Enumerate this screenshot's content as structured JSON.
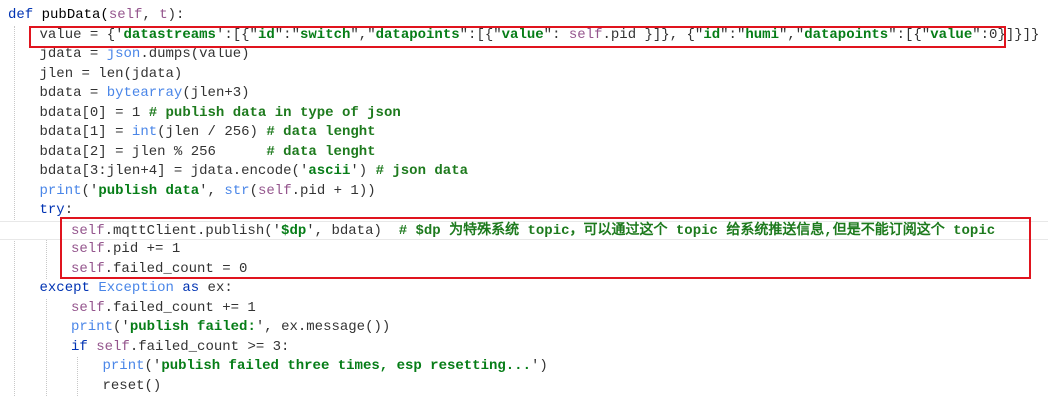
{
  "editor": {
    "lines": [
      {
        "indent": 0,
        "tokens": [
          [
            "kw",
            "def "
          ],
          [
            "def",
            "pubData("
          ],
          [
            "self",
            "self"
          ],
          [
            "plain",
            ", "
          ],
          [
            "self",
            "t"
          ],
          [
            "plain",
            "):"
          ]
        ]
      },
      {
        "indent": 1,
        "tokens": [
          [
            "plain",
            "value = {'"
          ],
          [
            "str",
            "datastreams"
          ],
          [
            "plain",
            "':[{\""
          ],
          [
            "str",
            "id"
          ],
          [
            "plain",
            "\":\""
          ],
          [
            "str",
            "switch"
          ],
          [
            "plain",
            "\",\""
          ],
          [
            "str",
            "datapoints"
          ],
          [
            "plain",
            "\":[{\""
          ],
          [
            "str",
            "value"
          ],
          [
            "plain",
            "\": "
          ],
          [
            "self",
            "self"
          ],
          [
            "plain",
            ".pid }]}, {\""
          ],
          [
            "str",
            "id"
          ],
          [
            "plain",
            "\":\""
          ],
          [
            "str",
            "humi"
          ],
          [
            "plain",
            "\",\""
          ],
          [
            "str",
            "datapoints"
          ],
          [
            "plain",
            "\":[{\""
          ],
          [
            "str",
            "value"
          ],
          [
            "plain",
            "\":0}]}]}"
          ]
        ]
      },
      {
        "indent": 1,
        "tokens": [
          [
            "plain",
            "jdata = "
          ],
          [
            "builtin",
            "json"
          ],
          [
            "plain",
            ".dumps(value)"
          ]
        ]
      },
      {
        "indent": 1,
        "tokens": [
          [
            "plain",
            "jlen = len(jdata)"
          ]
        ]
      },
      {
        "indent": 1,
        "tokens": [
          [
            "plain",
            "bdata = "
          ],
          [
            "builtin",
            "bytearray"
          ],
          [
            "plain",
            "(jlen+3)"
          ]
        ]
      },
      {
        "indent": 1,
        "tokens": [
          [
            "plain",
            "bdata[0] = 1 "
          ],
          [
            "com",
            "# publish data in type of json"
          ]
        ]
      },
      {
        "indent": 1,
        "tokens": [
          [
            "plain",
            "bdata[1] = "
          ],
          [
            "builtin",
            "int"
          ],
          [
            "plain",
            "(jlen / 256) "
          ],
          [
            "com",
            "# data lenght"
          ]
        ]
      },
      {
        "indent": 1,
        "tokens": [
          [
            "plain",
            "bdata[2] = jlen % 256      "
          ],
          [
            "com",
            "# data lenght"
          ]
        ]
      },
      {
        "indent": 1,
        "tokens": [
          [
            "plain",
            "bdata[3:jlen+4] = jdata.encode('"
          ],
          [
            "str",
            "ascii"
          ],
          [
            "plain",
            "') "
          ],
          [
            "com",
            "# json data"
          ]
        ]
      },
      {
        "indent": 1,
        "tokens": [
          [
            "builtin",
            "print"
          ],
          [
            "plain",
            "('"
          ],
          [
            "str",
            "publish data"
          ],
          [
            "plain",
            "', "
          ],
          [
            "builtin",
            "str"
          ],
          [
            "plain",
            "("
          ],
          [
            "self",
            "self"
          ],
          [
            "plain",
            ".pid + 1))"
          ]
        ]
      },
      {
        "indent": 1,
        "tokens": [
          [
            "kw",
            "try"
          ],
          [
            "plain",
            ":"
          ]
        ]
      },
      {
        "indent": 2,
        "current": true,
        "tokens": [
          [
            "self",
            "self"
          ],
          [
            "plain",
            ".mqttClient.publish('"
          ],
          [
            "str",
            "$dp"
          ],
          [
            "plain",
            "', bdata)  "
          ],
          [
            "com",
            "# $dp 为特殊系统 topic，可以通过这个 topic 给系统推送信息,但是不能订阅这个 topic"
          ]
        ]
      },
      {
        "indent": 2,
        "tokens": [
          [
            "self",
            "self"
          ],
          [
            "plain",
            ".pid += 1"
          ]
        ]
      },
      {
        "indent": 2,
        "tokens": [
          [
            "self",
            "self"
          ],
          [
            "plain",
            ".failed_count = 0"
          ]
        ]
      },
      {
        "indent": 1,
        "tokens": [
          [
            "kw",
            "except "
          ],
          [
            "builtin",
            "Exception"
          ],
          [
            "kw",
            " as "
          ],
          [
            "plain",
            "ex:"
          ]
        ]
      },
      {
        "indent": 2,
        "tokens": [
          [
            "self",
            "self"
          ],
          [
            "plain",
            ".failed_count += 1"
          ]
        ]
      },
      {
        "indent": 2,
        "tokens": [
          [
            "builtin",
            "print"
          ],
          [
            "plain",
            "('"
          ],
          [
            "str",
            "publish failed:"
          ],
          [
            "plain",
            "', ex.message())"
          ]
        ]
      },
      {
        "indent": 2,
        "tokens": [
          [
            "kw",
            "if "
          ],
          [
            "self",
            "self"
          ],
          [
            "plain",
            ".failed_count >= 3:"
          ]
        ]
      },
      {
        "indent": 3,
        "tokens": [
          [
            "builtin",
            "print"
          ],
          [
            "plain",
            "('"
          ],
          [
            "str",
            "publish failed three times, esp resetting..."
          ],
          [
            "plain",
            "')"
          ]
        ]
      },
      {
        "indent": 3,
        "tokens": [
          [
            "plain",
            "reset()"
          ]
        ]
      }
    ]
  },
  "colors": {
    "highlight_box": "#e0141e",
    "keyword": "#0033b3",
    "self": "#94558d",
    "string": "#067d17",
    "comment": "#1d7a1d",
    "builtin": "#4a86e8"
  }
}
